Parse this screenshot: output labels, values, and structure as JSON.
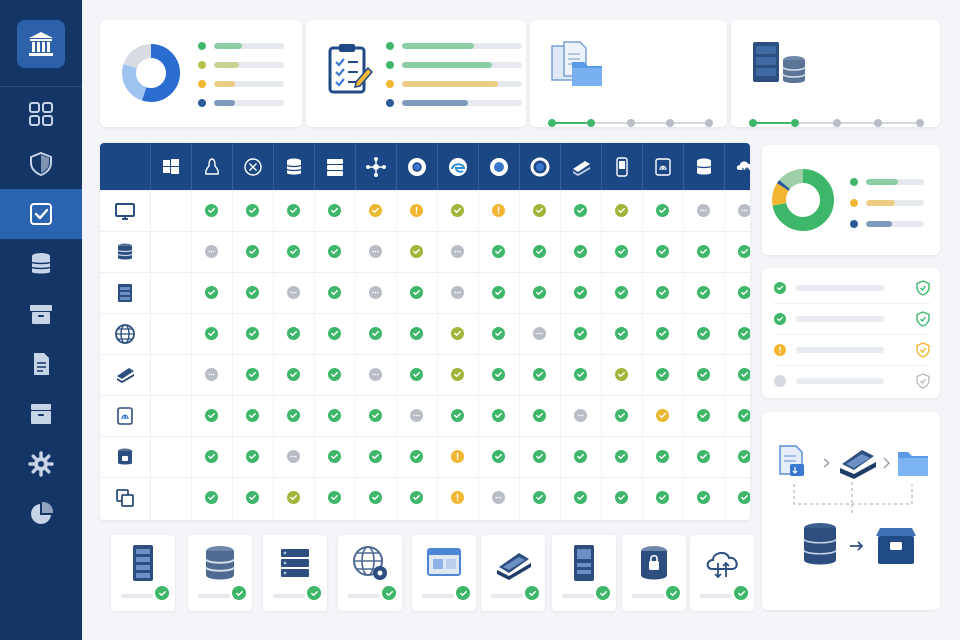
{
  "app": {
    "logo_icon": "bank-icon"
  },
  "sidebar": {
    "active_index": 2,
    "items": [
      {
        "id": "dashboard",
        "icon": "grid-icon"
      },
      {
        "id": "security",
        "icon": "shield-icon"
      },
      {
        "id": "compliance",
        "icon": "checkbox-icon"
      },
      {
        "id": "databases",
        "icon": "database-icon"
      },
      {
        "id": "archive",
        "icon": "archive-box-icon"
      },
      {
        "id": "documents",
        "icon": "document-icon"
      },
      {
        "id": "storage",
        "icon": "archive-drawer-icon"
      },
      {
        "id": "settings",
        "icon": "gear-icon"
      },
      {
        "id": "reports",
        "icon": "pie-chart-icon"
      }
    ]
  },
  "summary_cards": {
    "donut_legend": {
      "slices": [
        {
          "color": "#2b6cd1",
          "value": 0.55
        },
        {
          "color": "#9ec3ef",
          "value": 0.25
        },
        {
          "color": "#d8dde4",
          "value": 0.2
        }
      ],
      "legend": [
        {
          "color": "#3fb76a",
          "level": 0.4
        },
        {
          "color": "#b5c14a",
          "level": 0.35
        },
        {
          "color": "#f2b632",
          "level": 0.3
        },
        {
          "color": "#2b5a97",
          "level": 0.3
        }
      ]
    },
    "clipboard": {
      "icon": "clipboard-checklist-icon",
      "legend": [
        {
          "color": "#3fb76a",
          "level": 0.6
        },
        {
          "color": "#3fb76a",
          "level": 0.75
        },
        {
          "color": "#f2b632",
          "level": 0.8
        },
        {
          "color": "#2b5a97",
          "level": 0.55
        }
      ]
    },
    "files": {
      "icon": "files-folder-icon",
      "progress_steps": 5,
      "completed_steps": 2
    },
    "servers": {
      "icon": "server-database-icon",
      "progress_steps": 5,
      "completed_steps": 2
    }
  },
  "matrix": {
    "columns": [
      "windows-icon",
      "linux-icon",
      "x-circle-icon",
      "database-icon",
      "server-icon",
      "network-hub-icon",
      "chrome-icon",
      "edge-icon",
      "firefox-icon",
      "ring-icon",
      "scanner-icon",
      "device-icon",
      "fingerprint-doc-icon",
      "database-stack-icon",
      "cloud-sync-icon"
    ],
    "rows": [
      {
        "icon": "monitor-icon",
        "cells": [
          "g",
          "g",
          "g",
          "g",
          "y",
          "!",
          "o",
          "!",
          "o",
          "g",
          "o",
          "g",
          "n",
          "n"
        ]
      },
      {
        "icon": "database-icon",
        "cells": [
          "n",
          "g",
          "g",
          "g",
          "n",
          "o",
          "n",
          "g",
          "g",
          "g",
          "g",
          "g",
          "g",
          "g"
        ]
      },
      {
        "icon": "server-icon",
        "cells": [
          "g",
          "g",
          "n",
          "g",
          "n",
          "g",
          "n",
          "g",
          "g",
          "g",
          "g",
          "g",
          "g",
          "g"
        ]
      },
      {
        "icon": "globe-icon",
        "cells": [
          "g",
          "g",
          "g",
          "g",
          "g",
          "g",
          "o",
          "g",
          "n",
          "g",
          "g",
          "g",
          "g",
          "g"
        ]
      },
      {
        "icon": "scanner-icon",
        "cells": [
          "n",
          "g",
          "g",
          "g",
          "n",
          "g",
          "o",
          "g",
          "g",
          "g",
          "o",
          "g",
          "g",
          "g"
        ]
      },
      {
        "icon": "fingerprint-doc-icon",
        "cells": [
          "g",
          "g",
          "g",
          "g",
          "g",
          "n",
          "g",
          "g",
          "g",
          "n",
          "g",
          "y",
          "g",
          "g"
        ]
      },
      {
        "icon": "lock-database-icon",
        "cells": [
          "g",
          "g",
          "n",
          "g",
          "g",
          "g",
          "!",
          "g",
          "g",
          "g",
          "g",
          "g",
          "g",
          "g"
        ]
      },
      {
        "icon": "copy-windows-icon",
        "cells": [
          "g",
          "g",
          "o",
          "g",
          "g",
          "g",
          "!",
          "n",
          "g",
          "g",
          "g",
          "g",
          "g",
          "g"
        ]
      }
    ],
    "status_colors": {
      "g": "#3fb76a",
      "o": "#a2b53a",
      "y": "#e9b730",
      "!": "#f2b632",
      "n": "#b9bec6"
    }
  },
  "donut_card": {
    "slices": [
      {
        "color": "#3fb76a",
        "value": 0.72
      },
      {
        "color": "#f2b632",
        "value": 0.12
      },
      {
        "color": "#2b5a97",
        "value": 0.02
      },
      {
        "color": "#9ecfa9",
        "value": 0.14
      }
    ],
    "legend": [
      {
        "color": "#3fb76a",
        "level": 0.55
      },
      {
        "color": "#f2b632",
        "level": 0.5
      },
      {
        "color": "#2b5a97",
        "level": 0.45
      }
    ]
  },
  "checklist": [
    {
      "status": "ok",
      "shield": "#3fb76a"
    },
    {
      "status": "ok",
      "shield": "#3fb76a"
    },
    {
      "status": "warning",
      "shield": "#f2b632"
    },
    {
      "status": "pending",
      "shield": "#b9bec6"
    }
  ],
  "flow": {
    "nodes": [
      "document-icon",
      "scanner-icon",
      "folder-icon",
      "database-icon",
      "archive-box-icon"
    ]
  },
  "tiles": [
    "server-rack-icon",
    "database-icon",
    "server-icon",
    "globe-gear-icon",
    "browser-window-icon",
    "scanner-icon",
    "server-tower-icon",
    "lock-database-icon",
    "cloud-sync-icon"
  ]
}
